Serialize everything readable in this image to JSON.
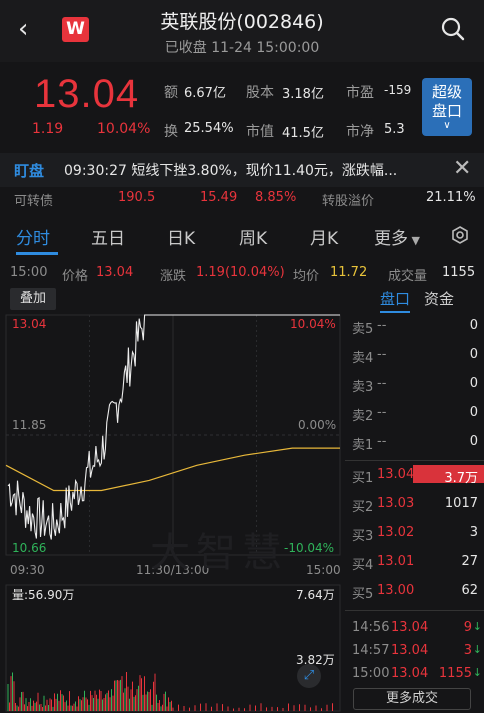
{
  "header": {
    "back_icon": "chevron-left-icon",
    "app_logo_text": "W",
    "title": "英联股份(002846)",
    "status": "已收盘 11-24 15:00:00",
    "search_icon": "search-icon"
  },
  "quote": {
    "price": "13.04",
    "change": "1.19",
    "change_pct": "10.04%",
    "fields": [
      {
        "label": "额",
        "value": "6.67亿"
      },
      {
        "label": "股本",
        "value": "3.18亿"
      },
      {
        "label": "市盈",
        "value": "-159"
      },
      {
        "label": "换",
        "value": "25.54%"
      },
      {
        "label": "市值",
        "value": "41.5亿"
      },
      {
        "label": "市净",
        "value": "5.3"
      }
    ],
    "super_button": "超级\n盘口"
  },
  "monitor": {
    "tag": "盯盘",
    "text": "09:30:27 短线下挫3.80%，现价11.40元，涨跌幅..."
  },
  "bond_row": {
    "label": "可转债",
    "price": "190.5",
    "change": "15.49",
    "pct": "8.85%",
    "premium_label": "转股溢价",
    "premium": "21.11%"
  },
  "tabs": [
    "分时",
    "五日",
    "日K",
    "周K",
    "月K",
    "更多"
  ],
  "info_bar": {
    "time": "15:00",
    "price_label": "价格",
    "price": "13.04",
    "change_label": "涨跌",
    "change": "1.19(10.04%)",
    "avg_label": "均价",
    "avg": "11.72",
    "volume_label": "成交量",
    "volume": "1155"
  },
  "chart": {
    "overlay_button": "叠加",
    "y_high": "13.04",
    "y_mid": "11.85",
    "y_low": "10.66",
    "pct_high": "10.04%",
    "pct_mid": "0.00%",
    "pct_low": "-10.04%",
    "x_start": "09:30",
    "x_mid": "11:30/13:00",
    "x_end": "15:00",
    "volume_label": "量:56.90万",
    "vol_max": "7.64万",
    "vol_mid": "3.82万",
    "watermark": "大智慧"
  },
  "chart_data": {
    "type": "line",
    "title": "",
    "ylim": [
      10.66,
      13.04
    ],
    "x": [
      "09:30",
      "11:30/13:00",
      "15:00"
    ],
    "series": [
      {
        "name": "价格",
        "values": [
          11.35,
          11.05,
          10.95,
          11.3,
          11.65,
          12.35,
          13.04,
          13.04
        ]
      },
      {
        "name": "均价",
        "values": [
          11.55,
          11.3,
          11.3,
          11.4,
          11.55,
          11.65,
          11.72,
          11.72
        ]
      }
    ]
  },
  "orderbook": {
    "tabs": [
      "盘口",
      "资金"
    ],
    "asks": [
      {
        "label": "卖5",
        "price": "--",
        "vol": "0"
      },
      {
        "label": "卖4",
        "price": "--",
        "vol": "0"
      },
      {
        "label": "卖3",
        "price": "--",
        "vol": "0"
      },
      {
        "label": "卖2",
        "price": "--",
        "vol": "0"
      },
      {
        "label": "卖1",
        "price": "--",
        "vol": "0"
      }
    ],
    "bids": [
      {
        "label": "买1",
        "price": "13.04",
        "vol": "3.7万"
      },
      {
        "label": "买2",
        "price": "13.03",
        "vol": "1017"
      },
      {
        "label": "买3",
        "price": "13.02",
        "vol": "3"
      },
      {
        "label": "买4",
        "price": "13.01",
        "vol": "27"
      },
      {
        "label": "买5",
        "price": "13.00",
        "vol": "62"
      }
    ],
    "trades": [
      {
        "time": "14:56",
        "price": "13.04",
        "vol": "9"
      },
      {
        "time": "14:57",
        "price": "13.04",
        "vol": "3"
      },
      {
        "time": "15:00",
        "price": "13.04",
        "vol": "1155"
      }
    ],
    "more_button": "更多成交"
  }
}
